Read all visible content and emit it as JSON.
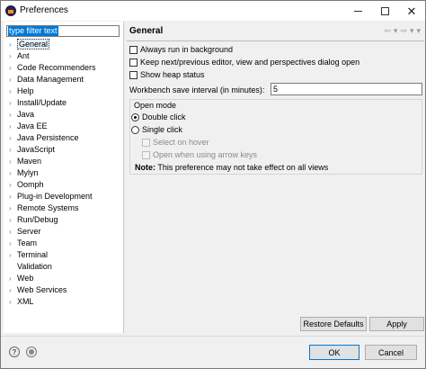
{
  "window": {
    "title": "Preferences"
  },
  "sidebar": {
    "filter_text": "type filter text",
    "items": [
      {
        "label": "General",
        "expandable": true,
        "selected": true
      },
      {
        "label": "Ant",
        "expandable": true
      },
      {
        "label": "Code Recommenders",
        "expandable": true
      },
      {
        "label": "Data Management",
        "expandable": true
      },
      {
        "label": "Help",
        "expandable": true
      },
      {
        "label": "Install/Update",
        "expandable": true
      },
      {
        "label": "Java",
        "expandable": true
      },
      {
        "label": "Java EE",
        "expandable": true
      },
      {
        "label": "Java Persistence",
        "expandable": true
      },
      {
        "label": "JavaScript",
        "expandable": true
      },
      {
        "label": "Maven",
        "expandable": true
      },
      {
        "label": "Mylyn",
        "expandable": true
      },
      {
        "label": "Oomph",
        "expandable": true
      },
      {
        "label": "Plug-in Development",
        "expandable": true
      },
      {
        "label": "Remote Systems",
        "expandable": true
      },
      {
        "label": "Run/Debug",
        "expandable": true
      },
      {
        "label": "Server",
        "expandable": true
      },
      {
        "label": "Team",
        "expandable": true
      },
      {
        "label": "Terminal",
        "expandable": true
      },
      {
        "label": "Validation",
        "expandable": false
      },
      {
        "label": "Web",
        "expandable": true
      },
      {
        "label": "Web Services",
        "expandable": true
      },
      {
        "label": "XML",
        "expandable": true
      }
    ]
  },
  "main": {
    "title": "General",
    "options": {
      "always_run_background": "Always run in background",
      "keep_next_previous": "Keep next/previous editor, view and perspectives dialog open",
      "show_heap_status": "Show heap status"
    },
    "save_interval_label": "Workbench save interval (in minutes):",
    "save_interval_value": "5",
    "open_mode": {
      "title": "Open mode",
      "double_click": "Double click",
      "single_click": "Single click",
      "select_on_hover": "Select on hover",
      "open_arrow_keys": "Open when using arrow keys",
      "note_label": "Note:",
      "note_text": " This preference may not take effect on all views"
    },
    "restore_defaults_label": "Restore Defaults",
    "apply_label": "Apply"
  },
  "footer": {
    "ok_label": "OK",
    "cancel_label": "Cancel"
  }
}
